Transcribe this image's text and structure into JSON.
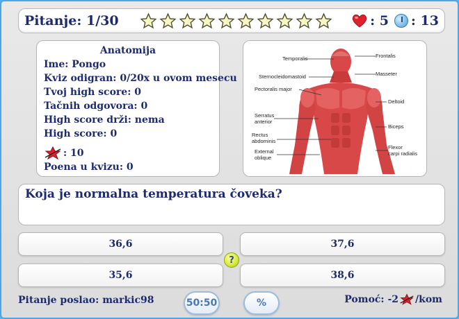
{
  "header": {
    "question_counter": "Pitanje: 1/30",
    "stars_total": 10,
    "lives": ": 5",
    "time": ": 13"
  },
  "info": {
    "category": "Anatomija",
    "name": "Ime: Pongo",
    "played": "Kviz odigran: 0/20x u ovom mesecu",
    "high_score": "Tvoj high score: 0",
    "correct": "Tačnih odgovora: 0",
    "holder": "High score drži: nema",
    "score": "High score: 0",
    "badge_count": ": 10",
    "quiz_points": "Poena u kvizu: 0"
  },
  "image": {
    "labels_left": [
      "Temporalis",
      "Sternocleidomastoid",
      "Pectoralis major",
      "Serratus",
      "anterior",
      "Rectus",
      "abdominis",
      "External",
      "oblique"
    ],
    "labels_right": [
      "Frontalis",
      "Masseter",
      "Deltoid",
      "Biceps",
      "Flexor",
      "carpi radialis"
    ]
  },
  "question": {
    "text": "Koja je normalna temperatura čoveka?"
  },
  "answers": [
    "36,6",
    "37,6",
    "35,6",
    "38,6"
  ],
  "footer": {
    "sender": "Pitanje poslao: markic98",
    "fifty_fifty": "50:50",
    "percent": "%",
    "help_prefix": "Pomoć: -2",
    "help_suffix": "/kom"
  },
  "colors": {
    "background": "#59b4f0",
    "text": "#1d2a6e",
    "heart": "#e0202a",
    "muscle": "#d94848"
  }
}
